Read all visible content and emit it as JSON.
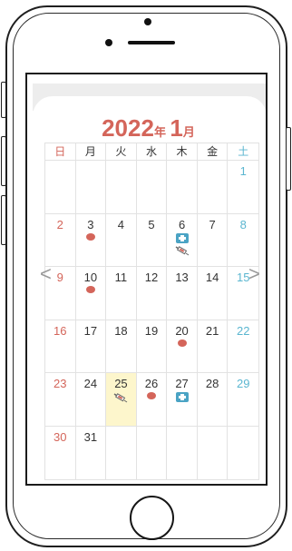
{
  "calendar": {
    "year": "2022",
    "year_suffix": "年",
    "month": "1",
    "month_suffix": "月",
    "weekdays": [
      "日",
      "月",
      "火",
      "水",
      "木",
      "金",
      "土"
    ],
    "weeks": [
      [
        "",
        "",
        "",
        "",
        "",
        "",
        "1"
      ],
      [
        "2",
        "3",
        "4",
        "5",
        "6",
        "7",
        "8"
      ],
      [
        "9",
        "10",
        "11",
        "12",
        "13",
        "14",
        "15"
      ],
      [
        "16",
        "17",
        "18",
        "19",
        "20",
        "21",
        "22"
      ],
      [
        "23",
        "24",
        "25",
        "26",
        "27",
        "28",
        "29"
      ],
      [
        "30",
        "31",
        "",
        "",
        "",
        "",
        ""
      ]
    ],
    "today": "25"
  },
  "nav": {
    "prev_label": "<",
    "next_label": ">"
  },
  "colors": {
    "accent": "#d4655a",
    "saturday": "#5bb6d0",
    "today_bg": "#fdf6cc"
  }
}
